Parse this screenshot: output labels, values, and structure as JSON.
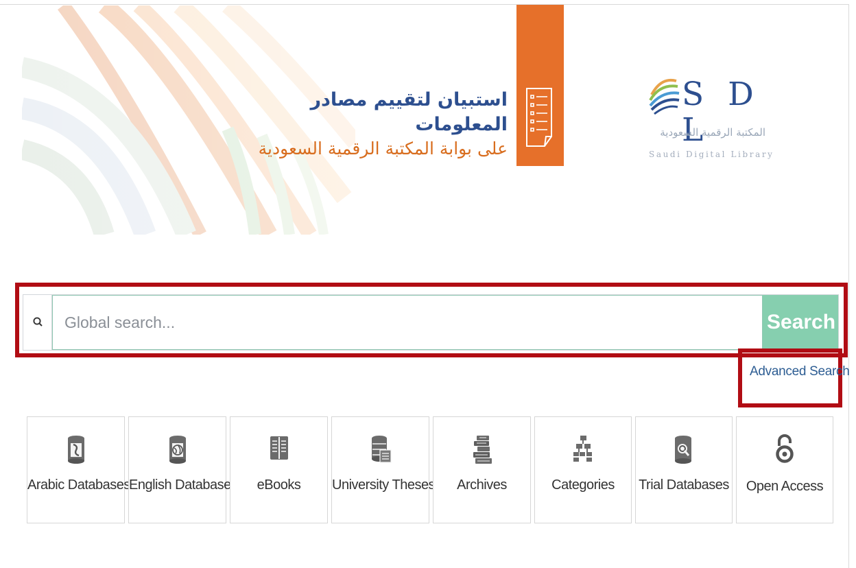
{
  "banner": {
    "survey_title_line1": "استبيان لتقييم مصادر المعلومات",
    "survey_title_line2": "على بوابة المكتبة الرقمية السعودية",
    "logo_letters": "S D L",
    "logo_arabic": "المكتبة الرقمية السعودية",
    "logo_english": "Saudi Digital Library"
  },
  "search": {
    "icon": "search-icon",
    "placeholder": "Global search...",
    "value": "",
    "button_label": "Search",
    "advanced_label": "Advanced Search"
  },
  "tiles": [
    {
      "label": "Arabic Databases",
      "icon": "database-arabic-icon"
    },
    {
      "label": "English Databases",
      "icon": "database-globe-icon"
    },
    {
      "label": "eBooks",
      "icon": "book-icon"
    },
    {
      "label": "University Theses",
      "icon": "server-stack-icon"
    },
    {
      "label": "Archives",
      "icon": "archive-books-icon"
    },
    {
      "label": "Categories",
      "icon": "sitemap-icon"
    },
    {
      "label": "Trial Databases",
      "icon": "database-search-icon"
    },
    {
      "label": "Open Access",
      "icon": "open-access-icon"
    }
  ],
  "colors": {
    "highlight_border": "#b10d14",
    "search_button": "#86cfaf",
    "survey_card": "#e6702a",
    "brand_blue": "#2d4f8f",
    "brand_orange": "#d86d1e"
  }
}
